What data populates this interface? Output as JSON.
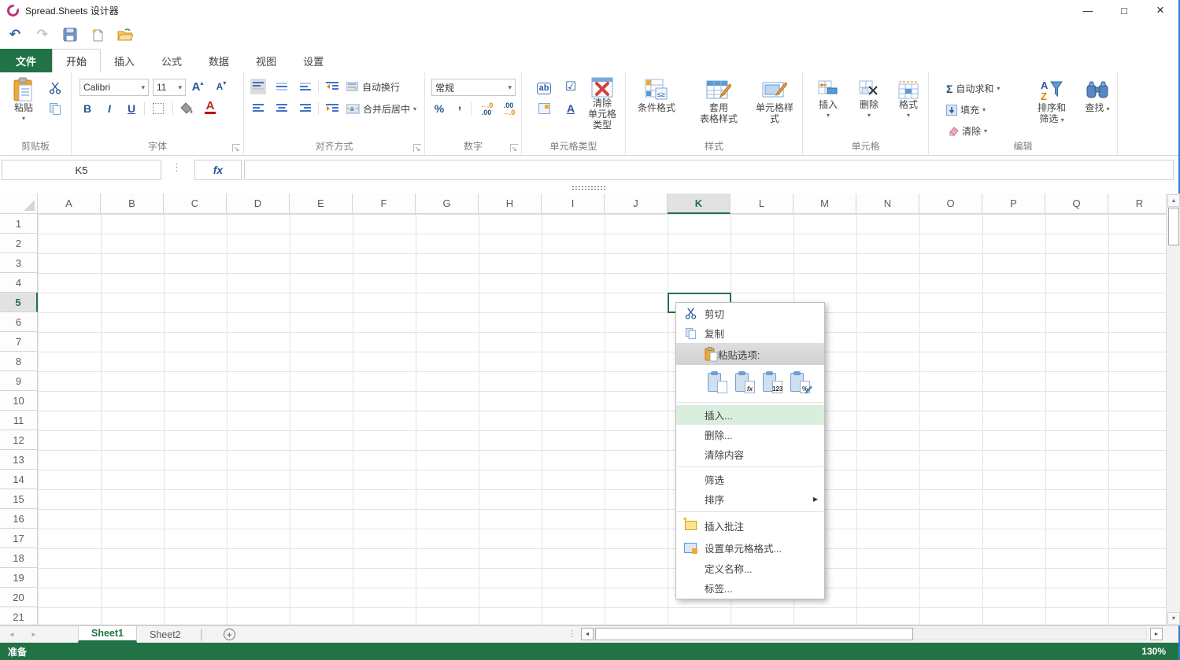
{
  "window": {
    "title": "Spread.Sheets 设计器"
  },
  "icons": {
    "undo": "↶",
    "redo": "↷",
    "dropdown": "▾",
    "submenu_arrow": "▶",
    "scroll_up": "▲",
    "scroll_down": "▼",
    "scroll_left": "◄",
    "scroll_right": "►",
    "nav_left": "◄",
    "nav_right": "►",
    "add": "+",
    "dots_vertical": "⋮",
    "minimize": "—",
    "maximize": "□",
    "close": "×",
    "checkbox": "☑",
    "launcher": "↘",
    "sigma": "Σ"
  },
  "tabs": {
    "file": "文件",
    "items": [
      "开始",
      "插入",
      "公式",
      "数据",
      "视图",
      "设置"
    ],
    "active": "开始"
  },
  "ribbon": {
    "clipboard": {
      "group_label": "剪贴板",
      "paste_label": "粘贴"
    },
    "font": {
      "group_label": "字体",
      "font_family": "Calibri",
      "font_size": "11",
      "bold": "B",
      "italic": "I",
      "underline": "U",
      "grow": "A",
      "shrink": "A",
      "font_color": "A"
    },
    "alignment": {
      "group_label": "对齐方式",
      "wrap_text": "自动换行",
      "merge_center": "合并后居中"
    },
    "number": {
      "group_label": "数字",
      "format": "常规",
      "percent": "%",
      "comma": ",",
      "inc_top": "←.0",
      "inc_bottom": ".00",
      "dec_top": ".00",
      "dec_bottom": "→.0"
    },
    "cell_type": {
      "group_label": "单元格类型",
      "ab": "ab",
      "hyperlink": "A",
      "clear_lines": [
        "清除",
        "单元格",
        "类型"
      ]
    },
    "style": {
      "group_label": "样式",
      "conditional": "条件格式",
      "table_style_lines": [
        "套用",
        "表格样式"
      ],
      "cell_style_lines": [
        "单元格样",
        "式"
      ]
    },
    "cells": {
      "group_label": "单元格",
      "insert": "插入",
      "delete": "删除",
      "format": "格式"
    },
    "editing": {
      "group_label": "编辑",
      "autosum": "自动求和",
      "fill": "填充",
      "clear": "清除",
      "sort_filter_lines": [
        "排序和",
        "筛选"
      ],
      "find": "查找"
    }
  },
  "formula_bar": {
    "name_box": "K5",
    "fx": "fx",
    "formula": ""
  },
  "grid": {
    "columns": [
      "A",
      "B",
      "C",
      "D",
      "E",
      "F",
      "G",
      "H",
      "I",
      "J",
      "K",
      "L",
      "M",
      "N",
      "O",
      "P",
      "Q",
      "R"
    ],
    "rows": [
      "1",
      "2",
      "3",
      "4",
      "5",
      "6",
      "7",
      "8",
      "9",
      "10",
      "11",
      "12",
      "13",
      "14",
      "15",
      "16",
      "17",
      "18",
      "19",
      "20",
      "21"
    ],
    "selected_column": "K",
    "selected_row": "5",
    "selection": "K5"
  },
  "context_menu": {
    "cut": "剪切",
    "copy": "复制",
    "paste_options": "粘贴选项:",
    "paste_icon_labels": [
      "",
      "fx",
      "123",
      "%"
    ],
    "insert": "插入...",
    "delete": "删除...",
    "clear_contents": "清除内容",
    "filter": "筛选",
    "sort": "排序",
    "insert_comment": "插入批注",
    "format_cells": "设置单元格格式...",
    "define_name": "定义名称...",
    "tag": "标签..."
  },
  "sheet_bar": {
    "tabs": [
      "Sheet1",
      "Sheet2"
    ],
    "active": "Sheet1"
  },
  "status_bar": {
    "left": "准备",
    "zoom": "130%"
  },
  "colors": {
    "brand_green": "#217346",
    "menu_highlight": "#d9eedd",
    "accent_blue": "#2b579a"
  }
}
